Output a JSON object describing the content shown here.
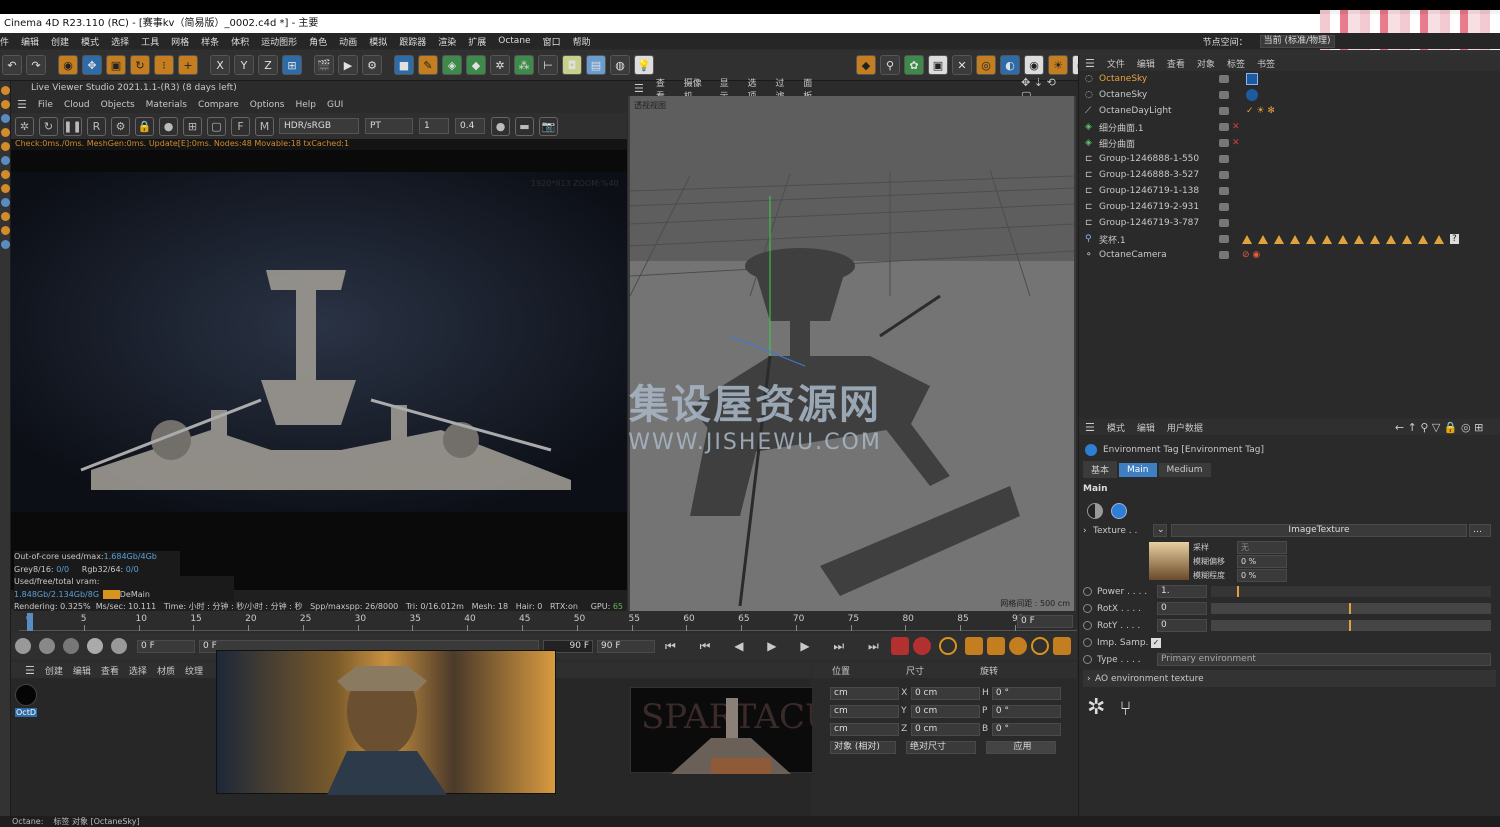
{
  "window": {
    "title": "Cinema 4D R23.110 (RC) - [赛事kv（简易版）_0002.c4d *] - 主要"
  },
  "menubar": {
    "items": [
      "件",
      "编辑",
      "创建",
      "模式",
      "选择",
      "工具",
      "网格",
      "样条",
      "体积",
      "运动图形",
      "角色",
      "动画",
      "模拟",
      "跟踪器",
      "渲染",
      "扩展",
      "Octane",
      "窗口",
      "帮助"
    ],
    "right_label": "节点空间：",
    "right_value": "当前 (标准/物理)"
  },
  "live_viewer": {
    "title": "Live Viewer Studio 2021.1.1-(R3) (8 days left)",
    "menu": [
      "File",
      "Cloud",
      "Objects",
      "Materials",
      "Compare",
      "Options",
      "Help",
      "GUI"
    ],
    "color_mode": "HDR/sRGB",
    "kernel": "PT",
    "field1": "1",
    "field2": "0.4",
    "status": "Check:0ms./0ms. MeshGen:0ms. Update[E]:0ms. Nodes:48 Movable:18 txCached:1",
    "resolution": "1920*813 ZOOM:%40",
    "stats": [
      {
        "label": "Out-of-core used/max:",
        "value": "1.684Gb/4Gb"
      },
      {
        "label": "Grey8/16:",
        "value": "0/0",
        "label2": "Rgb32/64:",
        "value2": "0/0"
      },
      {
        "label": "Used/free/total vram:",
        "value": "1.848Gb/2.134Gb/8G",
        "extra": "DeMain"
      }
    ],
    "rendering_line": {
      "rendering": "Rendering: 0.325%",
      "mssec": "Ms/sec: 10.111",
      "time": "Time: 小时 : 分钟 : 秒/小时 : 分钟 : 秒",
      "spp": "Spp/maxspp: 26/8000",
      "tri": "Tri: 0/16.012m",
      "mesh": "Mesh: 18",
      "hair": "Hair: 0",
      "rtx": "RTX:on",
      "gpu": "GPU:",
      "gpu_val": "65"
    }
  },
  "viewport": {
    "menu": [
      "查看",
      "摄像机",
      "显示",
      "选项",
      "过滤",
      "面板"
    ],
    "view_name": "透视视图",
    "grid_spacing": "网格间距 : 500 cm"
  },
  "watermark": {
    "line1": "集设屋资源网",
    "line2": "WWW.JISHEWU.COM"
  },
  "object_manager": {
    "menu": [
      "文件",
      "编辑",
      "查看",
      "对象",
      "标签",
      "书签"
    ],
    "objects": [
      {
        "name": "OctaneSky",
        "highlight": true
      },
      {
        "name": "OctaneSky"
      },
      {
        "name": "OctaneDayLight"
      },
      {
        "name": "细分曲面.1"
      },
      {
        "name": "细分曲面"
      },
      {
        "name": "Group-1246888-1-550"
      },
      {
        "name": "Group-1246888-3-527"
      },
      {
        "name": "Group-1246719-1-138"
      },
      {
        "name": "Group-1246719-2-931"
      },
      {
        "name": "Group-1246719-3-787"
      },
      {
        "name": "奖杯.1"
      },
      {
        "name": "OctaneCamera"
      }
    ]
  },
  "attributes": {
    "menu": [
      "模式",
      "编辑",
      "用户数据"
    ],
    "tag_title": "Environment Tag [Environment Tag]",
    "tabs": [
      "基本",
      "Main",
      "Medium"
    ],
    "section": "Main",
    "texture_label": "Texture . .",
    "texture_value": "ImageTexture",
    "sampling_label": "采样",
    "sampling_value": "无",
    "blur_offset_label": "模糊偏移",
    "blur_offset_value": "0 %",
    "blur_scale_label": "模糊程度",
    "blur_scale_value": "0 %",
    "power_label": "Power . . . .",
    "power_value": "1.",
    "power_level": 0.1,
    "rotx_label": "RotX . . . .",
    "rotx_value": "0",
    "roty_label": "RotY . . . .",
    "roty_value": "0",
    "imp_label": "Imp. Samp.",
    "type_label": "Type . . . .",
    "type_value": "Primary environment",
    "ao_label": "AO environment texture"
  },
  "timeline": {
    "ticks": [
      "0",
      "5",
      "10",
      "15",
      "20",
      "25",
      "30",
      "35",
      "40",
      "45",
      "50",
      "55",
      "60",
      "65",
      "70",
      "75",
      "80",
      "85",
      "90"
    ],
    "current": "0 F",
    "start": "0 F",
    "end": "90 F",
    "end2": "90 F",
    "right_frame": "0 F"
  },
  "material_manager": {
    "menu": [
      "创建",
      "编辑",
      "查看",
      "选择",
      "材质",
      "纹理"
    ],
    "material_name": "OctD"
  },
  "coords": {
    "headers": [
      "位置",
      "尺寸",
      "旋转"
    ],
    "rows": [
      {
        "pos": "cm",
        "axis": "X",
        "size": "0 cm",
        "rlabel": "H",
        "rot": "0 °"
      },
      {
        "pos": "cm",
        "axis": "Y",
        "size": "0 cm",
        "rlabel": "P",
        "rot": "0 °"
      },
      {
        "pos": "cm",
        "axis": "Z",
        "size": "0 cm",
        "rlabel": "B",
        "rot": "0 °"
      }
    ],
    "mode1": "对象 (相对)",
    "mode2": "绝对尺寸",
    "apply": "应用"
  },
  "statusbar": {
    "text1": "Octane:",
    "text2": "标签 对象 [OctaneSky]"
  }
}
